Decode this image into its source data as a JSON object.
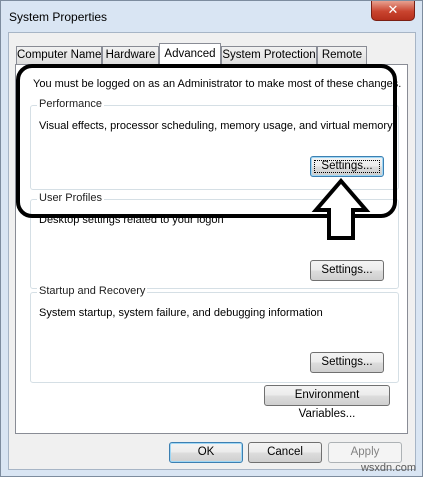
{
  "window": {
    "title": "System Properties",
    "close_glyph": "✕"
  },
  "tabs": [
    {
      "label": "Computer Name",
      "active": false
    },
    {
      "label": "Hardware",
      "active": false
    },
    {
      "label": "Advanced",
      "active": true
    },
    {
      "label": "System Protection",
      "active": false
    },
    {
      "label": "Remote",
      "active": false
    }
  ],
  "advanced": {
    "admin_message": "You must be logged on as an Administrator to make most of these changes.",
    "performance": {
      "title": "Performance",
      "description": "Visual effects, processor scheduling, memory usage, and virtual memory",
      "button": "Settings..."
    },
    "user_profiles": {
      "title": "User Profiles",
      "description": "Desktop settings related to your logon",
      "button": "Settings..."
    },
    "startup_recovery": {
      "title": "Startup and Recovery",
      "description": "System startup, system failure, and debugging information",
      "button": "Settings..."
    },
    "env_button": "Environment Variables..."
  },
  "footer": {
    "ok": "OK",
    "cancel": "Cancel",
    "apply": "Apply"
  },
  "watermark": "wsxdn.com",
  "colors": {
    "highlight_border": "#000000",
    "arrow_fill": "#ffffff",
    "close_button": "#c9442f"
  }
}
